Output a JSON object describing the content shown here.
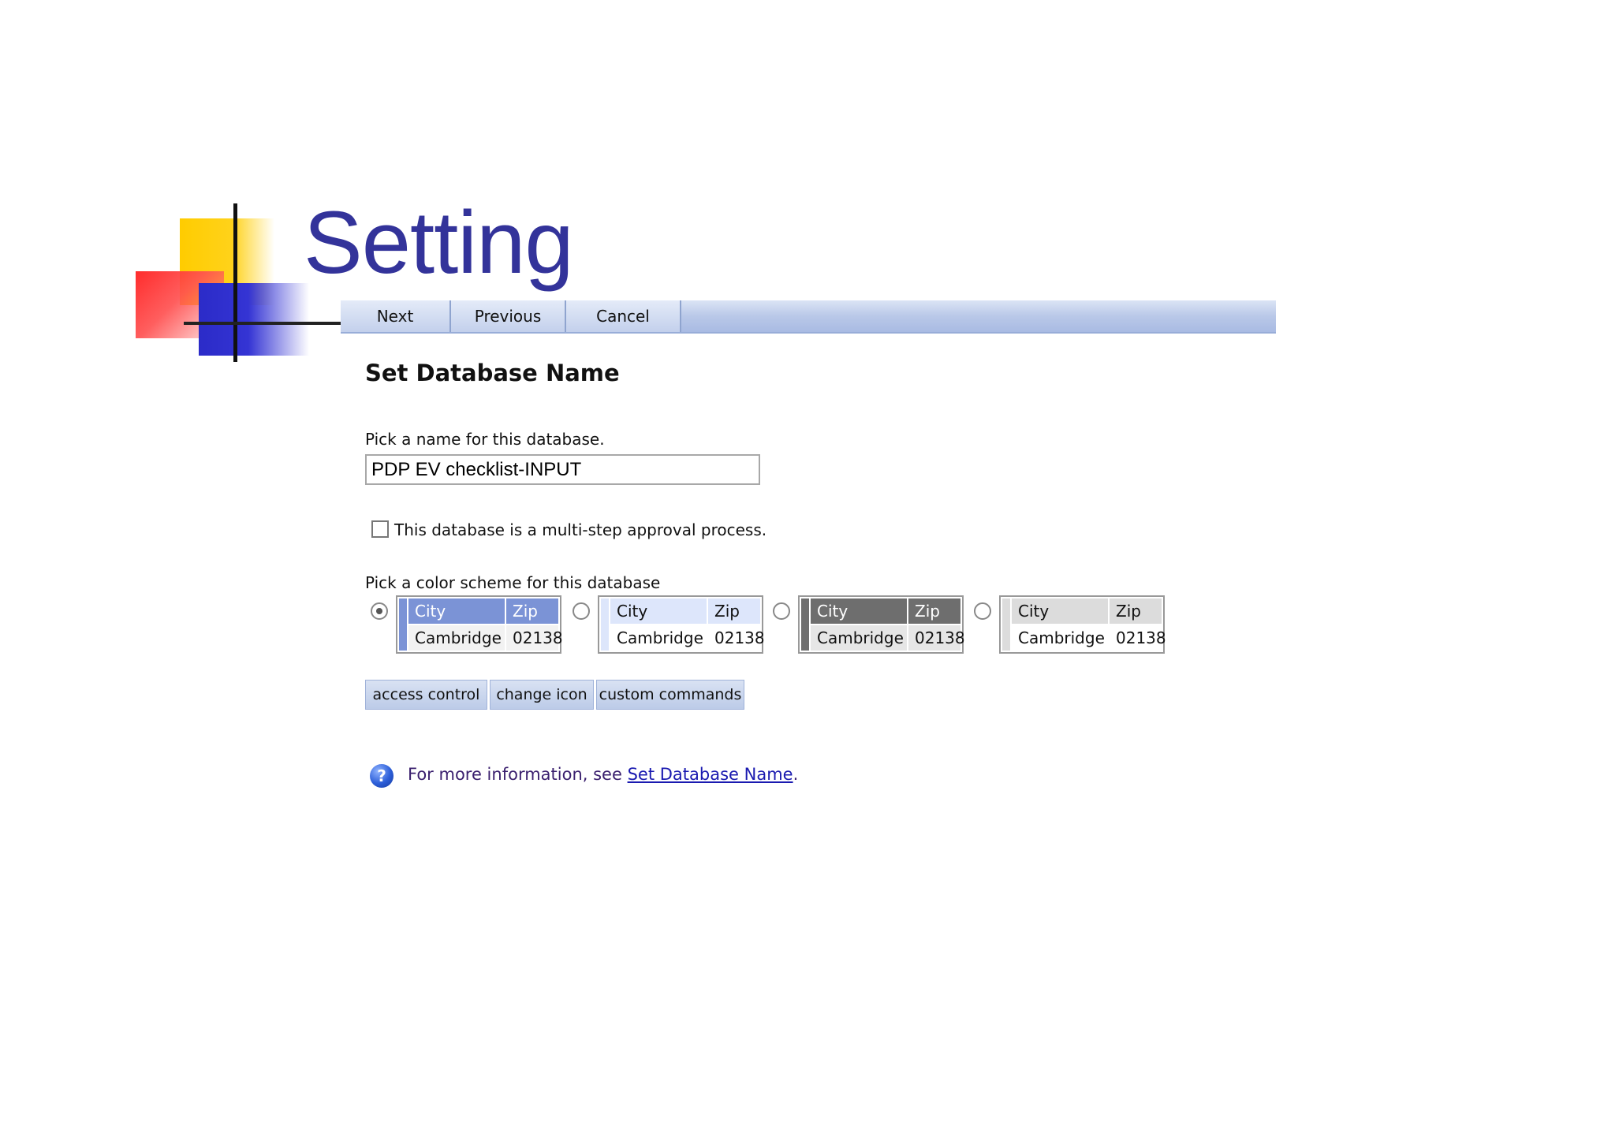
{
  "slide": {
    "title": "Setting"
  },
  "toolbar": {
    "next_label": "Next",
    "previous_label": "Previous",
    "cancel_label": "Cancel"
  },
  "form": {
    "heading": "Set Database Name",
    "name_prompt": "Pick a name for this database.",
    "name_value": "PDP EV checklist-INPUT",
    "multistep_label": "This database is a multi-step approval process.",
    "multistep_checked": false,
    "scheme_prompt": "Pick a color scheme for this database"
  },
  "schemes": [
    {
      "header_city": "City",
      "header_zip": "Zip",
      "body_city": "Cambridge",
      "body_zip": "02138",
      "header_bg": "#7b93d6",
      "header_fg": "#ffffff",
      "bar": "#7b93d6",
      "selected": true
    },
    {
      "header_city": "City",
      "header_zip": "Zip",
      "body_city": "Cambridge",
      "body_zip": "02138",
      "header_bg": "#dde6fb",
      "header_fg": "#111111",
      "bar": "#dde6fb",
      "selected": false
    },
    {
      "header_city": "City",
      "header_zip": "Zip",
      "body_city": "Cambridge",
      "body_zip": "02138",
      "header_bg": "#6e6e6e",
      "header_fg": "#ffffff",
      "bar": "#6e6e6e",
      "selected": false
    },
    {
      "header_city": "City",
      "header_zip": "Zip",
      "body_city": "Cambridge",
      "body_zip": "02138",
      "header_bg": "#dcdcdc",
      "header_fg": "#111111",
      "bar": "#dcdcdc",
      "selected": false
    }
  ],
  "options": {
    "access_control": "access control",
    "change_icon": "change icon",
    "custom_commands": "custom commands"
  },
  "help": {
    "prefix": "For more information, see ",
    "link": "Set Database Name",
    "suffix": "."
  }
}
